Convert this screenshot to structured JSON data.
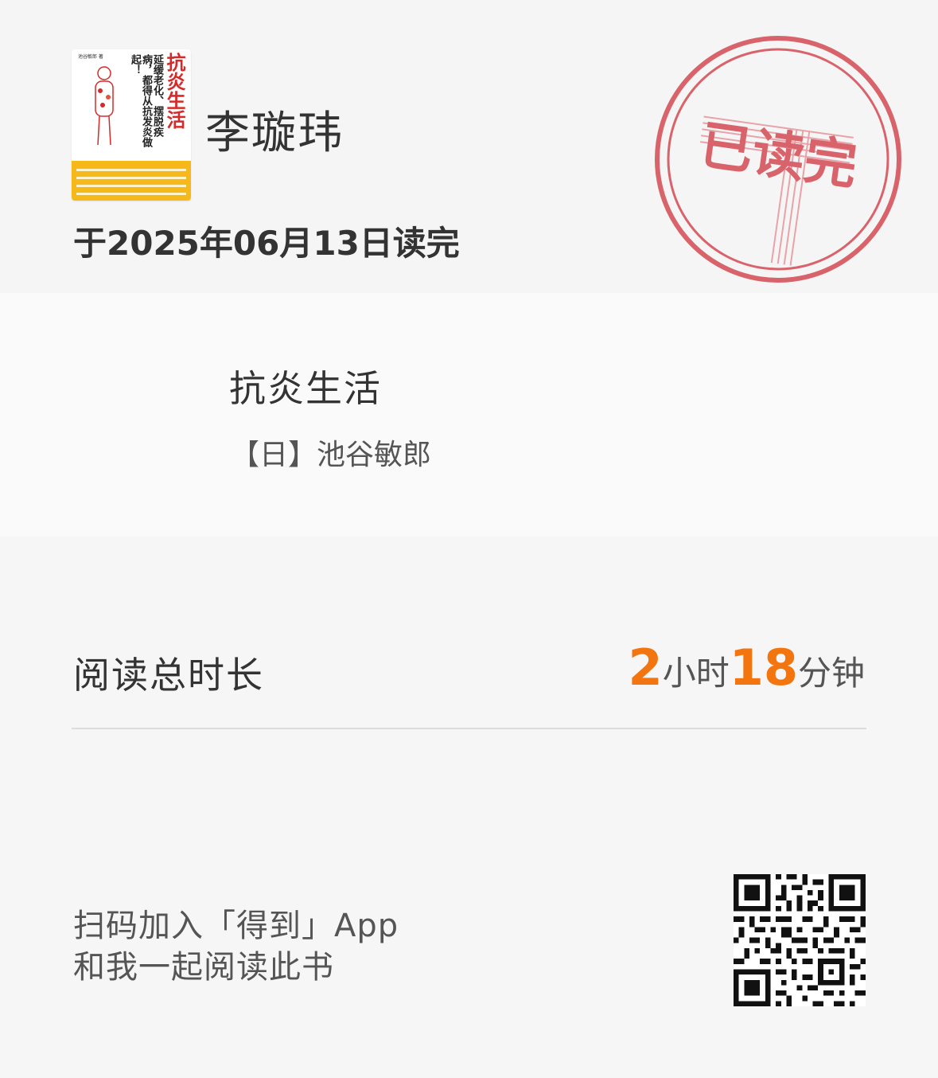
{
  "user": {
    "name": "李璇玮"
  },
  "finished_text": "于2025年06月13日读完",
  "stamp": {
    "text": "已读完",
    "color": "#d9636b"
  },
  "book": {
    "title": "抗炎生活",
    "author": "【日】池谷敏郎",
    "cover": {
      "title": "抗炎生活",
      "subtitle": "延缓老化、摆脱疾病，都得从抗发炎做起！",
      "author": "池谷敏郎 著"
    }
  },
  "reading": {
    "label": "阅读总时长",
    "hours": "2",
    "hours_unit": "小时",
    "minutes": "18",
    "minutes_unit": "分钟",
    "accent": "#f2750f"
  },
  "footer": {
    "line1": "扫码加入「得到」App",
    "line2": "和我一起阅读此书"
  }
}
